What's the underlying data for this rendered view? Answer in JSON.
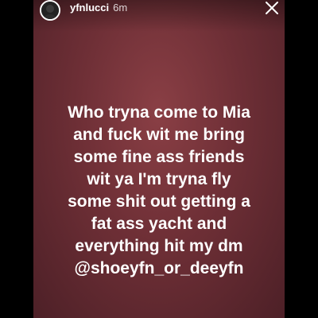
{
  "story": {
    "username": "yfnlucci",
    "timestamp": "6m",
    "text_lines": [
      "Who tryna come to Mia",
      "and fuck wit me bring",
      "some fine ass friends",
      "wit ya I'm tryna fly",
      "some shit out getting a",
      "fat ass yacht and",
      "everything hit my dm"
    ],
    "mention": "@shoeyfn_or_deeyfn",
    "background_colors": [
      "#8a3f45",
      "#6e2f36",
      "#4d2027"
    ],
    "icons": {
      "avatar": "profile-avatar",
      "close": "close-icon"
    }
  }
}
